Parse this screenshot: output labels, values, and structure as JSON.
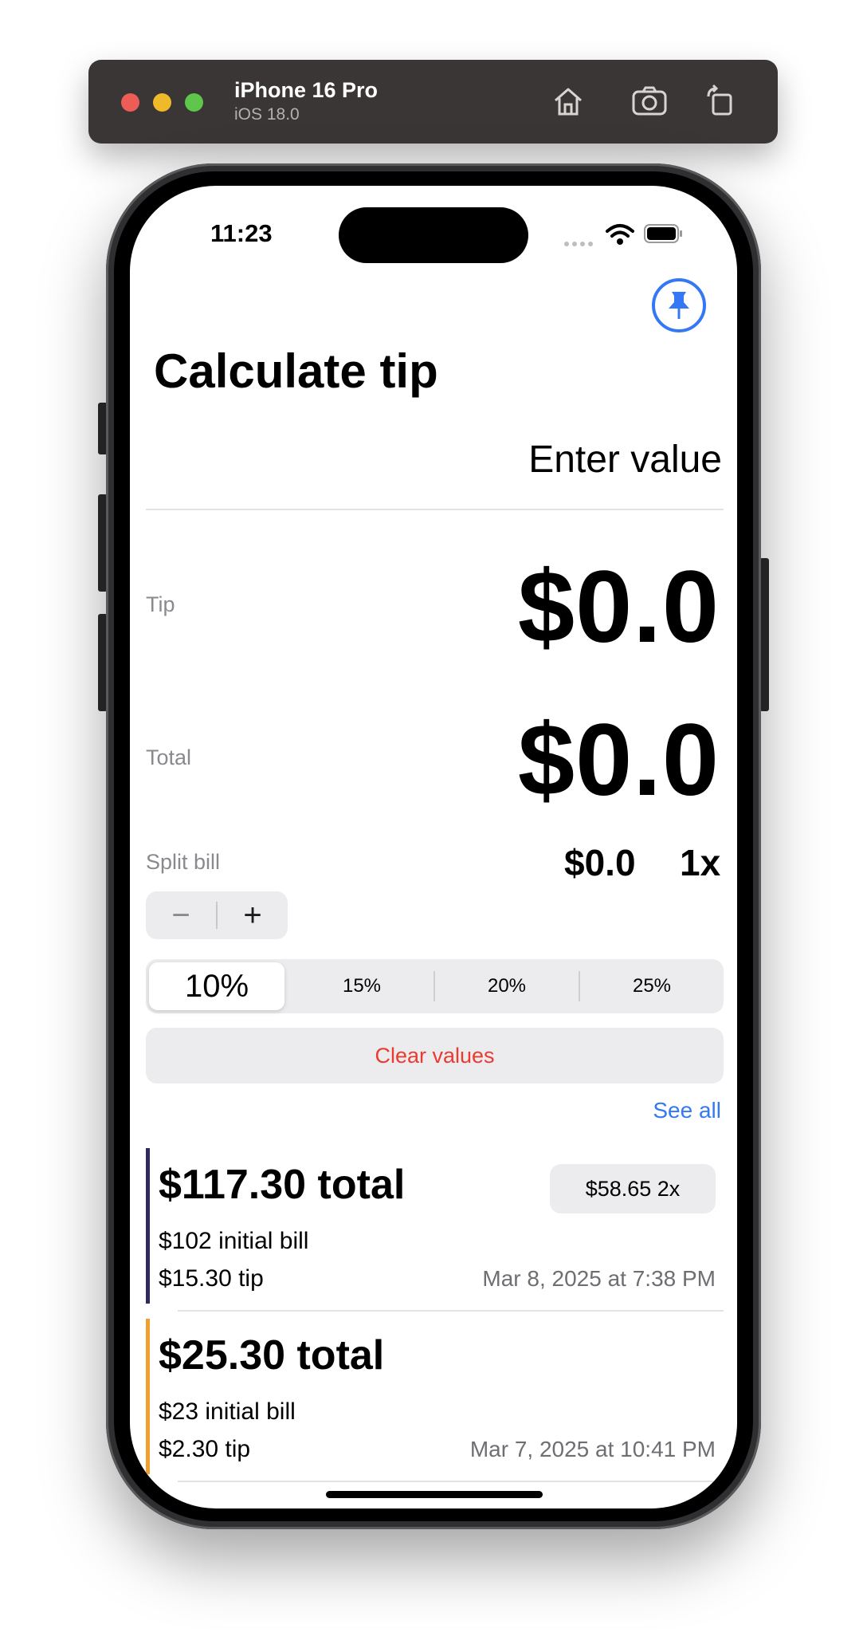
{
  "simulator": {
    "device_name": "iPhone 16 Pro",
    "os_version": "iOS 18.0",
    "icons": [
      "home-icon",
      "screenshot-icon",
      "rotate-icon"
    ]
  },
  "status_bar": {
    "time": "11:23",
    "icons": [
      "cellular-icon",
      "wifi-icon",
      "battery-icon"
    ]
  },
  "pin_button": {
    "icon": "pin-icon",
    "color": "#3478f6"
  },
  "title": "Calculate tip",
  "bill_input": {
    "placeholder": "Enter value",
    "value": ""
  },
  "tip": {
    "label": "Tip",
    "value": "$0.0"
  },
  "total": {
    "label": "Total",
    "value": "$0.0"
  },
  "split": {
    "label": "Split bill",
    "amount": "$0.0",
    "count": "1x",
    "minus_label": "−",
    "plus_label": "+"
  },
  "tip_options": [
    {
      "label": "10%",
      "selected": true
    },
    {
      "label": "15%",
      "selected": false
    },
    {
      "label": "20%",
      "selected": false
    },
    {
      "label": "25%",
      "selected": false
    }
  ],
  "clear_button": {
    "label": "Clear values",
    "color": "#eb3b30"
  },
  "see_all": {
    "label": "See all",
    "color": "#3478f6"
  },
  "history": [
    {
      "total": "$117.30 total",
      "initial_bill": "$102 initial bill",
      "tip": "$15.30 tip",
      "date": "Mar 8, 2025 at 7:38 PM",
      "split_badge": "$58.65 2x",
      "accent_color": "#2f2a5e"
    },
    {
      "total": "$25.30 total",
      "initial_bill": "$23 initial bill",
      "tip": "$2.30 tip",
      "date": "Mar 7, 2025 at 10:41 PM",
      "split_badge": "",
      "accent_color": "#f0a030"
    }
  ]
}
